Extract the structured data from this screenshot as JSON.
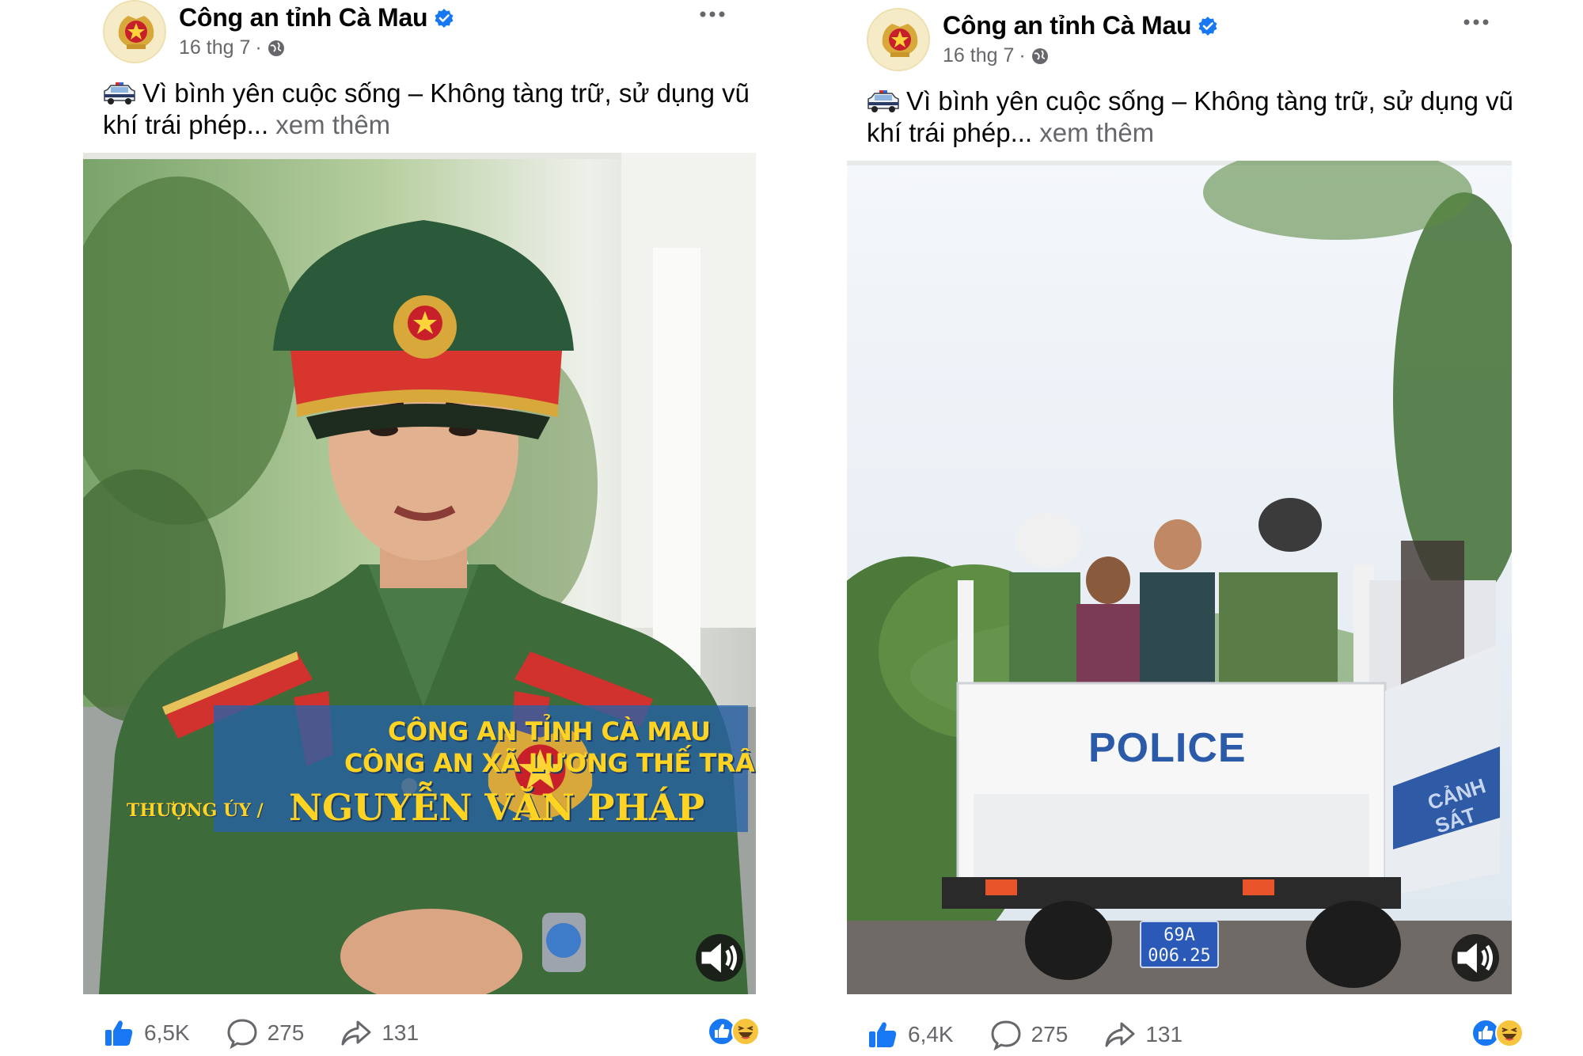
{
  "posts": [
    {
      "page_name": "Công an tỉnh Cà Mau",
      "date": "16 thg 7",
      "separator": "·",
      "caption_text": "Vì bình yên cuộc sống – Không tàng trữ, sử dụng vũ khí trái phép...",
      "see_more": "xem thêm",
      "overlay": {
        "line1": "CÔNG AN TỈNH CÀ MAU",
        "line2": "CÔNG AN XÃ LƯƠNG THẾ TRÂN",
        "rank": "THƯỢNG ÚY /",
        "name": "NGUYỄN VĂN PHÁP"
      },
      "likes": "6,5K",
      "comments": "275",
      "shares": "131"
    },
    {
      "page_name": "Công an tỉnh Cà Mau",
      "date": "16 thg 7",
      "separator": "·",
      "caption_text": "Vì bình yên cuộc sống – Không tàng trữ, sử dụng vũ khí trái phép...",
      "see_more": "xem thêm",
      "overlay": {
        "police": "POLICE",
        "side_text": "CẢNH SÁT",
        "plate_line1": "69A",
        "plate_line2": "006.25"
      },
      "likes": "6,4K",
      "comments": "275",
      "shares": "131"
    }
  ],
  "colors": {
    "accent": "#1877f2",
    "secondary_text": "#65676b",
    "overlay_yellow": "#ffd322",
    "overlay_blue": "#2662a8"
  },
  "icons": [
    "police-emblem-icon",
    "verified-badge-icon",
    "globe-icon",
    "more-options-icon",
    "police-car-icon",
    "volume-icon",
    "like-icon",
    "comment-icon",
    "share-icon",
    "like-reaction-icon",
    "haha-reaction-icon"
  ]
}
